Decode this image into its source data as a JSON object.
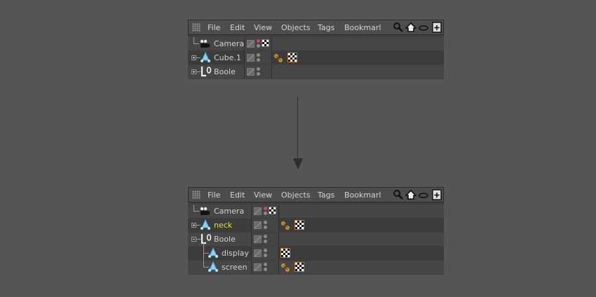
{
  "menu": {
    "file": "File",
    "edit": "Edit",
    "view": "View",
    "objects": "Objects",
    "tags": "Tags",
    "bookmarks": "Bookmarl"
  },
  "top_panel": {
    "objects": [
      {
        "label": "Camera",
        "icon": "camera-icon"
      },
      {
        "label": "Cube.1",
        "icon": "cube-icon"
      },
      {
        "label": "Boole",
        "icon": "boole-icon"
      }
    ]
  },
  "bottom_panel": {
    "objects": [
      {
        "label": "Camera",
        "icon": "camera-icon"
      },
      {
        "label": "neck",
        "icon": "cube-icon",
        "highlight": true
      },
      {
        "label": "Boole",
        "icon": "boole-icon"
      },
      {
        "label": "display",
        "icon": "cube-icon"
      },
      {
        "label": "screen",
        "icon": "cube-icon"
      }
    ]
  },
  "colors": {
    "background": "#555555",
    "highlight_text": "#e8df3c",
    "tag_border": "#c9752b"
  }
}
